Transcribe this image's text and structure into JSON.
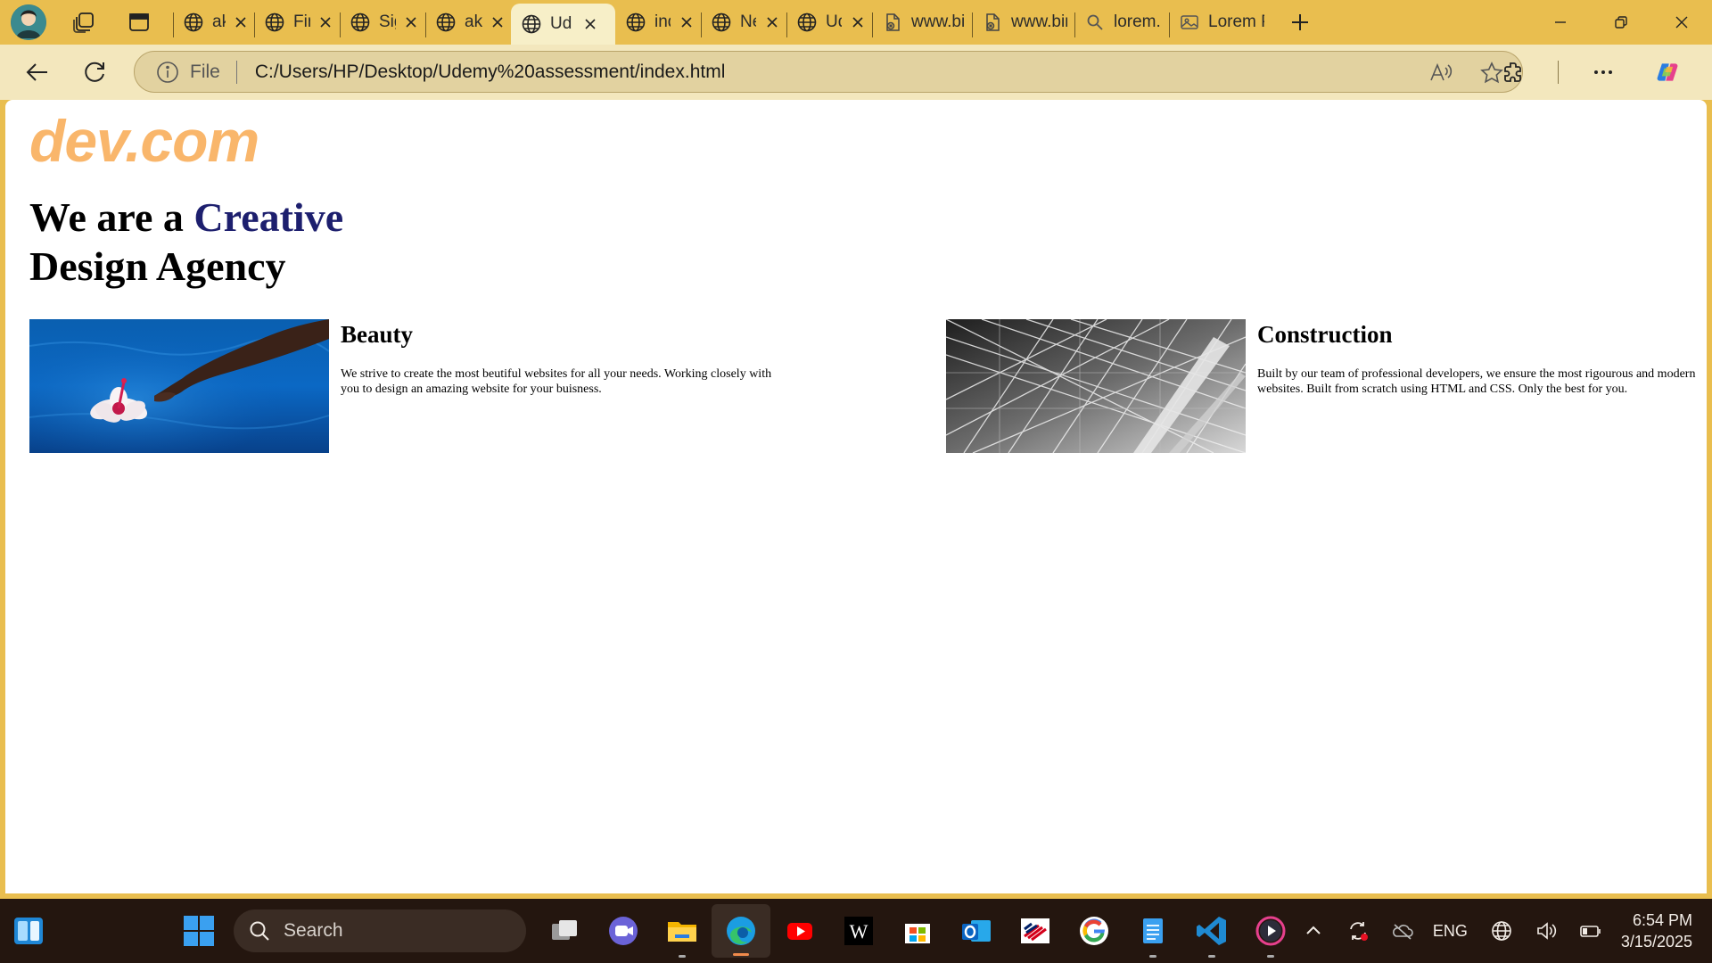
{
  "browser": {
    "tabs": [
      {
        "title": "aka",
        "favicon": "globe-icon",
        "closable": true,
        "active": false
      },
      {
        "title": "Fin",
        "favicon": "globe-icon",
        "closable": true,
        "active": false
      },
      {
        "title": "Sig",
        "favicon": "globe-icon",
        "closable": true,
        "active": false
      },
      {
        "title": "aka",
        "favicon": "globe-icon",
        "closable": true,
        "active": false
      },
      {
        "title": "Ud",
        "favicon": "globe-icon",
        "closable": true,
        "active": true
      },
      {
        "title": "ind",
        "favicon": "globe-icon",
        "closable": true,
        "active": false
      },
      {
        "title": "Ne",
        "favicon": "globe-icon",
        "closable": true,
        "active": false
      },
      {
        "title": "Ud",
        "favicon": "globe-icon",
        "closable": true,
        "active": false
      },
      {
        "title": "www.bir",
        "favicon": "file-icon",
        "closable": false,
        "active": false
      },
      {
        "title": "www.bir",
        "favicon": "file-icon",
        "closable": false,
        "active": false
      },
      {
        "title": "lorem.p",
        "favicon": "search-icon",
        "closable": false,
        "active": false
      },
      {
        "title": "Lorem P",
        "favicon": "image-icon",
        "closable": false,
        "active": false
      }
    ],
    "address": {
      "scheme_label": "File",
      "url": "C:/Users/HP/Desktop/Udemy%20assessment/index.html"
    },
    "accent_color": "#e9be4f"
  },
  "page": {
    "logo": "dev.com",
    "headline_part1": "We are a ",
    "headline_accent": "Creative",
    "headline_part2": "Design Agency",
    "cards": [
      {
        "title": "Beauty",
        "text": "We strive to create the most beutiful websites for all your needs. Working closely with you to design an amazing website for your buisness.",
        "image": "hand-with-flower-in-water"
      },
      {
        "title": "Construction",
        "text": "Built by our team of professional developers, we ensure the most rigourous and modern websites. Built from scratch using HTML and CSS. Only the best for you.",
        "image": "steel-truss-structure"
      }
    ],
    "logo_color": "#f9b66b",
    "accent_color": "#1d1f6e"
  },
  "taskbar": {
    "search_label": "Search",
    "apps": [
      "task-view",
      "teams",
      "file-explorer",
      "edge",
      "youtube",
      "wikipedia",
      "microsoft-store",
      "outlook",
      "bank-of-america",
      "google",
      "notepad",
      "vscode",
      "media-player"
    ],
    "language": "ENG",
    "time": "6:54 PM",
    "date": "3/15/2025"
  }
}
